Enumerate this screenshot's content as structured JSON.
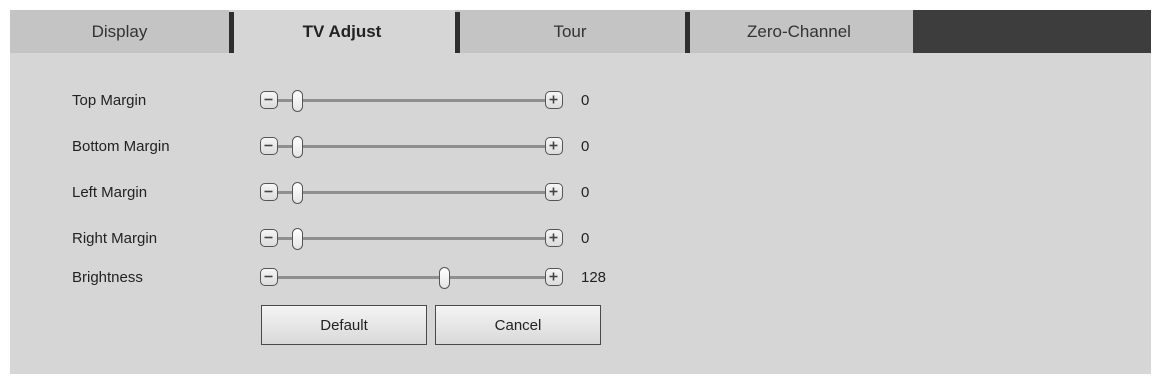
{
  "tabs": [
    {
      "label": "Display",
      "active": false
    },
    {
      "label": "TV Adjust",
      "active": true
    },
    {
      "label": "Tour",
      "active": false
    },
    {
      "label": "Zero-Channel",
      "active": false
    }
  ],
  "settings": [
    {
      "label": "Top Margin",
      "value": "0",
      "fraction": 0.0
    },
    {
      "label": "Bottom Margin",
      "value": "0",
      "fraction": 0.0
    },
    {
      "label": "Left Margin",
      "value": "0",
      "fraction": 0.0
    },
    {
      "label": "Right Margin",
      "value": "0",
      "fraction": 0.0
    },
    {
      "label": "Brightness",
      "value": "128",
      "fraction": 0.589
    }
  ],
  "buttons": {
    "default_label": "Default",
    "cancel_label": "Cancel"
  },
  "icons": {
    "decrease": "minus-icon",
    "increase": "plus-icon"
  },
  "colors": {
    "panel_bg": "#d6d6d6",
    "tab_inactive_bg": "#c4c4c4",
    "tab_filler_bg": "#3d3d3d",
    "tab_separator": "#2e2e2e"
  }
}
